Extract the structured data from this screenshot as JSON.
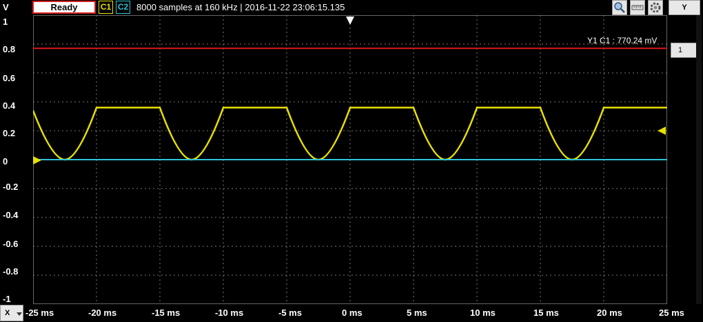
{
  "header": {
    "y_unit": "V",
    "status_label": "Ready",
    "channel1_label": "C1",
    "channel2_label": "C2",
    "acquisition_info": "8000 samples at 160 kHz | 2016-11-22 23:06:15.135",
    "y_axis_select": "Y",
    "icons": [
      "zoom-icon",
      "ruler-icon",
      "settings-icon"
    ]
  },
  "cursor": {
    "label": "Y1 C1 : 770.24 mV",
    "value_v": 0.77024,
    "select_value": "1",
    "color": "#e01818"
  },
  "x_axis_select": "X",
  "chart_data": {
    "type": "line",
    "ylim": [
      -1,
      1
    ],
    "xlim": [
      -25,
      25
    ],
    "yticks": [
      "1",
      "0.8",
      "0.6",
      "0.4",
      "0.2",
      "0",
      "-0.2",
      "-0.4",
      "-0.6",
      "-0.8",
      "-1"
    ],
    "xticks": [
      "-25 ms",
      "-20 ms",
      "-15 ms",
      "-10 ms",
      "-5 ms",
      "0 ms",
      "5 ms",
      "10 ms",
      "15 ms",
      "20 ms",
      "25 ms"
    ],
    "grid": true,
    "series": [
      {
        "name": "C1",
        "color": "#e8e000",
        "x": [
          -25,
          -22.5,
          -20,
          -15,
          -12.5,
          -10,
          -5,
          -2.5,
          0,
          5,
          7.5,
          10,
          15,
          17.5,
          20,
          25
        ],
        "y": [
          0.34,
          0,
          0.36,
          0.36,
          0,
          0.36,
          0.36,
          0,
          0.36,
          0.36,
          0,
          0.36,
          0.36,
          0,
          0.36,
          0.36
        ]
      },
      {
        "name": "C2",
        "color": "#2ec4d8",
        "x": [
          -25,
          25
        ],
        "y": [
          0,
          0
        ]
      }
    ]
  }
}
